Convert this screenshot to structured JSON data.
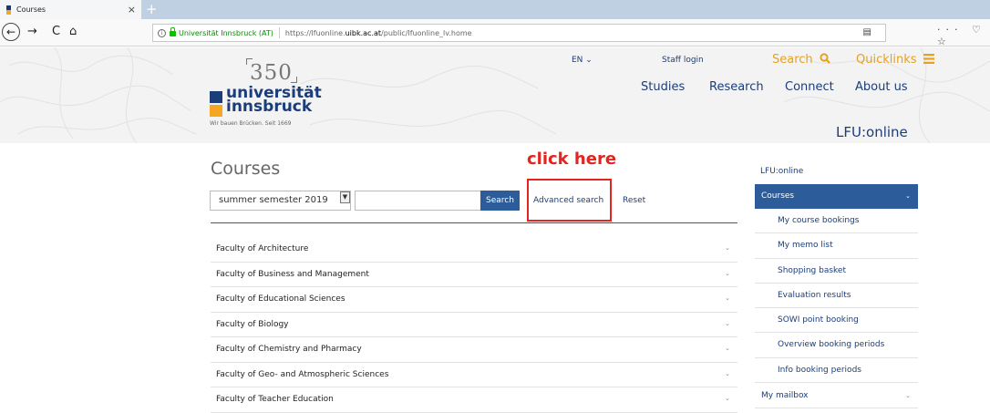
{
  "browser": {
    "tab_title": "Courses",
    "tab_close": "×",
    "new_tab": "+",
    "back": "←",
    "forward": "→",
    "reload": "C",
    "home": "⌂",
    "url_org": "Universität Innsbruck (AT)",
    "url_prefix": "https://lfuonline.",
    "url_host": "uibk.ac.at",
    "url_path": "/public/lfuonline_lv.home",
    "tools": "··· ♡ ☆"
  },
  "header": {
    "logo_350": "350",
    "logo_line1": "universität",
    "logo_line2": "innsbruck",
    "logo_claim": "Wir bauen Brücken. Seit 1669",
    "lang": "EN ⌄",
    "staff_login": "Staff login",
    "search": "Search",
    "search_icon": "search-icon",
    "quicklinks": "Quicklinks",
    "quicklinks_icon": "menu-icon",
    "nav": [
      "Studies",
      "Research",
      "Connect",
      "About us"
    ],
    "lfu_title": "LFU:online"
  },
  "main": {
    "heading": "Courses",
    "annotation": "click here",
    "semester": "summer semester 2019",
    "search_button": "Search",
    "advanced_search": "Advanced search",
    "reset": "Reset",
    "faculties": [
      "Faculty of Architecture",
      "Faculty of Business and Management",
      "Faculty of Educational Sciences",
      "Faculty of Biology",
      "Faculty of Chemistry and Pharmacy",
      "Faculty of Geo- and Atmospheric Sciences",
      "Faculty of Teacher Education"
    ]
  },
  "sidebar": {
    "root": "LFU:online",
    "courses": "Courses",
    "sub_items": [
      "My course bookings",
      "My memo list",
      "Shopping basket",
      "Evaluation results",
      "SOWI point booking",
      "Overview booking periods",
      "Info booking periods"
    ],
    "mailbox": "My mailbox"
  },
  "colors": {
    "brand_blue": "#1b3d7a",
    "accent_orange": "#e7a11f",
    "button_blue": "#2c5c99",
    "annotation_red": "#e3241f"
  }
}
